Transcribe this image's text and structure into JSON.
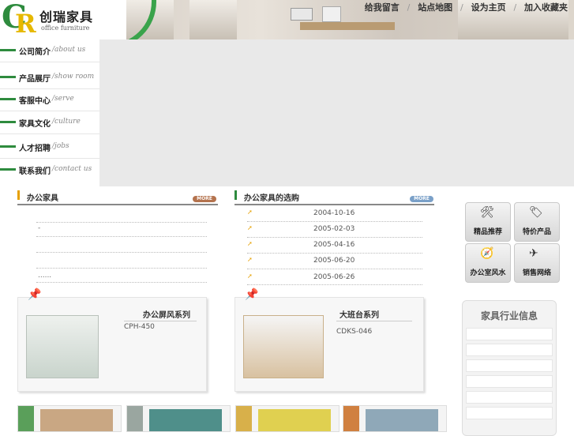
{
  "header": {
    "logo_text": "创瑞家具",
    "logo_sub": "office furniture",
    "logo_letters": "CR",
    "top_links": [
      "给我留言",
      "站点地图",
      "设为主页",
      "加入收藏夹"
    ]
  },
  "leftnav": {
    "items": [
      {
        "cn": "公司简介",
        "en": "/about us"
      },
      {
        "cn": "产品展厅",
        "en": "/show room"
      },
      {
        "cn": "客服中心",
        "en": "/serve"
      },
      {
        "cn": "家具文化",
        "en": "/culture"
      },
      {
        "cn": "人才招聘",
        "en": "/jobs"
      },
      {
        "cn": "联系我们",
        "en": "/contact us"
      }
    ]
  },
  "office_furniture": {
    "title": "办公家具",
    "more": "MORE",
    "items": [
      "-",
      "......"
    ]
  },
  "selection": {
    "title": "办公家具的选购",
    "more": "MORE",
    "dates": [
      "2004-10-16",
      "2005-02-03",
      "2005-04-16",
      "2005-06-20",
      "2005-06-26"
    ]
  },
  "products": [
    {
      "name": "办公屏风系列",
      "code": "CPH-450"
    },
    {
      "name": "大班台系列",
      "code": "CDKS-046"
    }
  ],
  "right": {
    "tiles": [
      "精品推荐",
      "特价产品",
      "办公室风水",
      "销售网络"
    ],
    "info_title": "家具行业信息"
  },
  "colors": {
    "brand_green": "#2e8b3e",
    "accent_orange": "#e6a000"
  }
}
